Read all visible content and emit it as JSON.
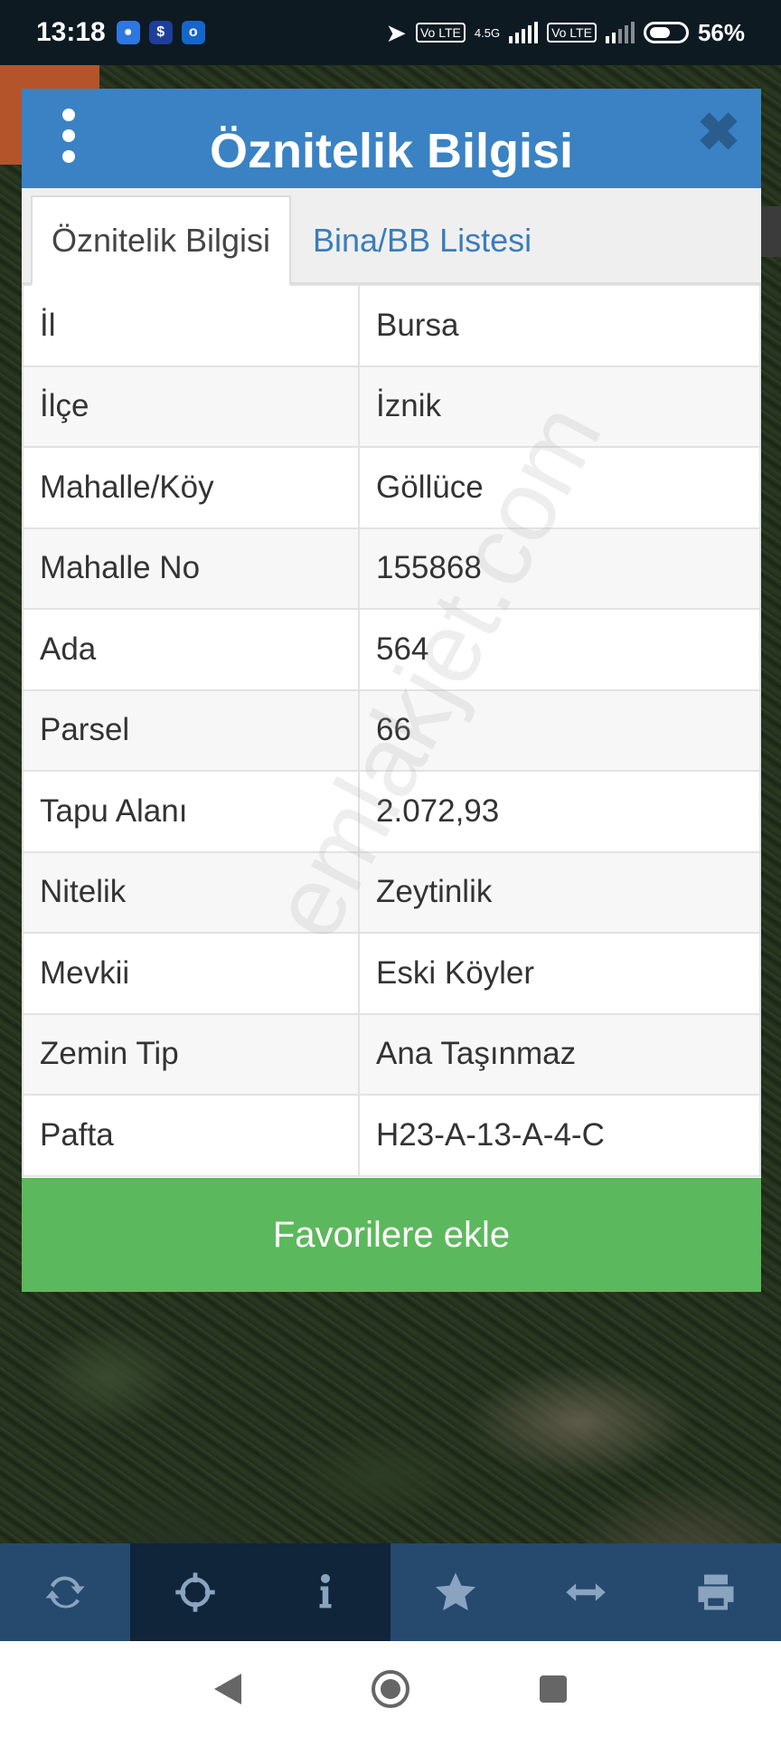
{
  "status_bar": {
    "time": "13:18",
    "network_label": "4.5G",
    "volte_label_1": "Vo LTE",
    "volte_label_2": "Vo LTE",
    "battery": "56%"
  },
  "dialog": {
    "title": "Öznitelik Bilgisi",
    "tabs": [
      {
        "label": "Öznitelik Bilgisi",
        "active": true
      },
      {
        "label": "Bina/BB Listesi",
        "active": false
      }
    ],
    "rows": [
      {
        "key": "İl",
        "value": "Bursa"
      },
      {
        "key": "İlçe",
        "value": "İznik"
      },
      {
        "key": "Mahalle/Köy",
        "value": "Göllüce"
      },
      {
        "key": "Mahalle No",
        "value": "155868"
      },
      {
        "key": "Ada",
        "value": "564"
      },
      {
        "key": "Parsel",
        "value": "66"
      },
      {
        "key": "Tapu Alanı",
        "value": "2.072,93"
      },
      {
        "key": "Nitelik",
        "value": "Zeytinlik"
      },
      {
        "key": "Mevkii",
        "value": "Eski Köyler"
      },
      {
        "key": "Zemin Tip",
        "value": "Ana Taşınmaz"
      },
      {
        "key": "Pafta",
        "value": "H23-A-13-A-4-C"
      }
    ],
    "favorite_button": "Favorilere ekle"
  },
  "watermark": "emlakjet.com",
  "toolbar": {
    "items": [
      {
        "icon": "refresh-icon",
        "active": false
      },
      {
        "icon": "crosshair-icon",
        "active": true
      },
      {
        "icon": "info-icon",
        "active": true
      },
      {
        "icon": "star-icon",
        "active": false
      },
      {
        "icon": "measure-arrows-icon",
        "active": false
      },
      {
        "icon": "print-icon",
        "active": false
      }
    ]
  },
  "colors": {
    "header": "#3a82c4",
    "favorite_button": "#5cb85c",
    "toolbar": "#26496e",
    "toolbar_active": "#10243a"
  }
}
